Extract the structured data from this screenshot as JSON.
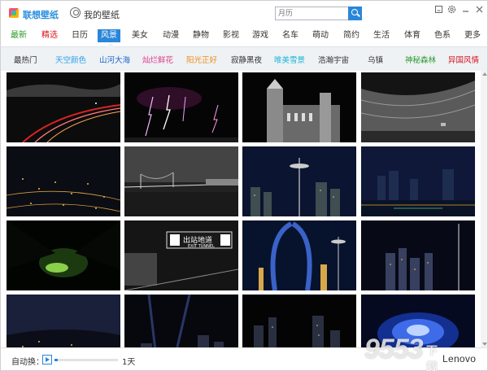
{
  "titlebar": {
    "tab_wallpaper": "联想壁纸",
    "tab_mine": "我的壁纸",
    "search_placeholder": "月历",
    "window_buttons": [
      "minimize-icon",
      "skin-icon",
      "gear-icon",
      "close-icon"
    ]
  },
  "categories": [
    {
      "label": "最新",
      "style": "green"
    },
    {
      "label": "精选",
      "style": "red"
    },
    {
      "label": "日历",
      "style": "normal"
    },
    {
      "label": "风景",
      "style": "active"
    },
    {
      "label": "美女",
      "style": "normal"
    },
    {
      "label": "动漫",
      "style": "normal"
    },
    {
      "label": "静物",
      "style": "normal"
    },
    {
      "label": "影视",
      "style": "normal"
    },
    {
      "label": "游戏",
      "style": "normal"
    },
    {
      "label": "名车",
      "style": "normal"
    },
    {
      "label": "萌动",
      "style": "normal"
    },
    {
      "label": "简约",
      "style": "normal"
    },
    {
      "label": "生活",
      "style": "normal"
    },
    {
      "label": "体育",
      "style": "normal"
    },
    {
      "label": "色系",
      "style": "normal"
    },
    {
      "label": "更多",
      "style": "normal"
    }
  ],
  "subtags": [
    {
      "label": "最热门",
      "color": "#333333"
    },
    {
      "label": "天空颜色",
      "color": "#2a9ee8"
    },
    {
      "label": "山河大海",
      "color": "#1a64c8"
    },
    {
      "label": "灿烂鲜花",
      "color": "#e0398a"
    },
    {
      "label": "阳光正好",
      "color": "#f08a10"
    },
    {
      "label": "寂静黑夜",
      "color": "#333333"
    },
    {
      "label": "唯美雪景",
      "color": "#22b5d8"
    },
    {
      "label": "浩瀚宇宙",
      "color": "#333333"
    },
    {
      "label": "乌镇",
      "color": "#333333"
    },
    {
      "label": "神秘森林",
      "color": "#2a9a2a"
    },
    {
      "label": "异国风情",
      "color": "#d8141e"
    }
  ],
  "wallpapers": [
    {
      "name": "night-highway"
    },
    {
      "name": "lightning-storm"
    },
    {
      "name": "city-hall-night"
    },
    {
      "name": "crescent-building"
    },
    {
      "name": "city-lights-aerial"
    },
    {
      "name": "bay-bridge-night"
    },
    {
      "name": "space-needle-skyline"
    },
    {
      "name": "waterfront-skyline"
    },
    {
      "name": "tree-tunnel-glow"
    },
    {
      "name": "exit-tunnel-station"
    },
    {
      "name": "space-needle-arches"
    },
    {
      "name": "tower-skyline"
    },
    {
      "name": "hillside-city"
    },
    {
      "name": "searchlights-skyline"
    },
    {
      "name": "skyscrapers-night"
    },
    {
      "name": "blue-fireworks"
    }
  ],
  "sign_text": {
    "main": "出站地道",
    "sub": "EXIT TUNNEL"
  },
  "footer": {
    "auto_label": "自动换：",
    "interval": "1天",
    "slider_level": 0.05,
    "brand": "Lenovo",
    "watermark": "9553"
  },
  "colors": {
    "accent": "#2a86d8",
    "subbar": "#eef2f5"
  }
}
